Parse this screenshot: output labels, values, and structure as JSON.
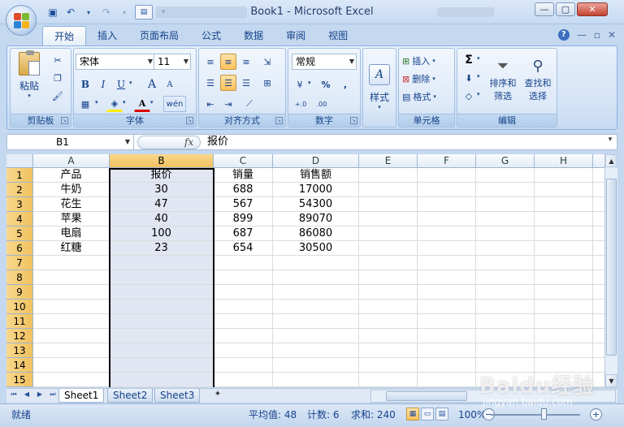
{
  "app": {
    "title": "Book1 - Microsoft Excel",
    "window_controls": {
      "minimize": "—",
      "restore": "▢",
      "close": "✕"
    }
  },
  "qat": {
    "save_icon": "save-icon",
    "undo_icon": "undo-icon",
    "redo_icon": "redo-icon"
  },
  "ribbon_tabs": [
    {
      "label": "开始",
      "active": true
    },
    {
      "label": "插入"
    },
    {
      "label": "页面布局"
    },
    {
      "label": "公式"
    },
    {
      "label": "数据"
    },
    {
      "label": "审阅"
    },
    {
      "label": "视图"
    }
  ],
  "ribbon_right": {
    "help": "?",
    "min": "—",
    "restore": "▫",
    "close": "✕"
  },
  "clipboard": {
    "paste_label": "粘贴",
    "group_label": "剪贴板"
  },
  "font": {
    "name": "宋体",
    "size": "11",
    "bold": "B",
    "italic": "I",
    "underline": "U",
    "grow": "A",
    "shrink": "A",
    "group_label": "字体",
    "phonetic": "wén"
  },
  "alignment": {
    "group_label": "对齐方式"
  },
  "number": {
    "format": "常规",
    "percent": "%",
    "comma": ",",
    "inc_dec": "+.0 .00",
    "dec_dec": ".00 →.0",
    "group_label": "数字"
  },
  "styles": {
    "label": "样式"
  },
  "cells": {
    "insert": "插入",
    "delete": "删除",
    "format": "格式",
    "group_label": "单元格"
  },
  "editing": {
    "sigma": "Σ",
    "sort_filter": "排序和",
    "sort_filter2": "筛选",
    "find_select": "查找和",
    "find_select2": "选择",
    "group_label": "编辑"
  },
  "formula_bar": {
    "name_box": "B1",
    "fx": "fx",
    "content": "报价"
  },
  "grid": {
    "columns": [
      "A",
      "B",
      "C",
      "D",
      "E",
      "F",
      "G",
      "H",
      "I"
    ],
    "rows": [
      "1",
      "2",
      "3",
      "4",
      "5",
      "6",
      "7",
      "8",
      "9",
      "10",
      "11",
      "12",
      "13",
      "14",
      "15"
    ],
    "selected_column": "B",
    "data": [
      [
        "产品",
        "报价",
        "销量",
        "销售额"
      ],
      [
        "牛奶",
        "30",
        "688",
        "17000"
      ],
      [
        "花生",
        "47",
        "567",
        "54300"
      ],
      [
        "苹果",
        "40",
        "899",
        "89070"
      ],
      [
        "电扇",
        "100",
        "687",
        "86080"
      ],
      [
        "红糖",
        "23",
        "654",
        "30500"
      ]
    ]
  },
  "sheet_tabs": [
    {
      "label": "Sheet1",
      "active": true
    },
    {
      "label": "Sheet2"
    },
    {
      "label": "Sheet3"
    }
  ],
  "status": {
    "ready": "就绪",
    "average": "平均值: 48",
    "count": "计数: 6",
    "sum": "求和: 240",
    "zoom": "100%"
  },
  "watermark": {
    "main": "Baidu经验",
    "sub": "jingyan.baidu.com"
  },
  "colors": {
    "accent": "#15428b",
    "selected_header": "#f1c15f",
    "grid_line": "#dadcdd"
  }
}
